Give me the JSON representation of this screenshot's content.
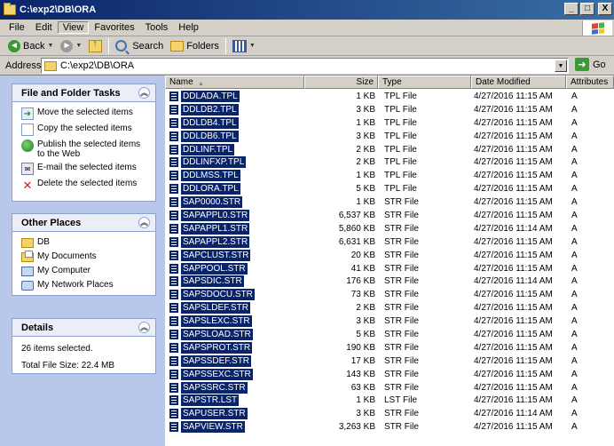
{
  "window": {
    "title": "C:\\exp2\\DB\\ORA",
    "min_label": "_",
    "max_label": "□",
    "close_label": "X"
  },
  "menu": [
    "File",
    "Edit",
    "View",
    "Favorites",
    "Tools",
    "Help"
  ],
  "toolbar": {
    "back_label": "Back",
    "search_label": "Search",
    "folders_label": "Folders"
  },
  "address": {
    "label": "Address",
    "value": "C:\\exp2\\DB\\ORA",
    "go_label": "Go"
  },
  "tasks_panel": {
    "title": "File and Folder Tasks",
    "items": [
      {
        "label": "Move the selected items",
        "icon": "move-icon"
      },
      {
        "label": "Copy the selected items",
        "icon": "copy-icon"
      },
      {
        "label": "Publish the selected items",
        "label2": "to the Web",
        "icon": "web-publish-icon"
      },
      {
        "label": "E-mail the selected items",
        "icon": "email-icon"
      },
      {
        "label": "Delete the selected items",
        "icon": "delete-icon"
      }
    ]
  },
  "places_panel": {
    "title": "Other Places",
    "items": [
      {
        "label": "DB",
        "icon": "folder-icon"
      },
      {
        "label": "My Documents",
        "icon": "my-documents-icon"
      },
      {
        "label": "My Computer",
        "icon": "my-computer-icon"
      },
      {
        "label": "My Network Places",
        "icon": "network-places-icon"
      }
    ]
  },
  "details_panel": {
    "title": "Details",
    "selected": "26 items selected.",
    "total_size": "Total File Size: 22.4 MB"
  },
  "columns": [
    "Name",
    "Size",
    "Type",
    "Date Modified",
    "Attributes"
  ],
  "files": [
    {
      "name": "DDLADA.TPL",
      "size": "1 KB",
      "type": "TPL File",
      "date": "4/27/2016 11:15 AM",
      "attr": "A"
    },
    {
      "name": "DDLDB2.TPL",
      "size": "3 KB",
      "type": "TPL File",
      "date": "4/27/2016 11:15 AM",
      "attr": "A"
    },
    {
      "name": "DDLDB4.TPL",
      "size": "1 KB",
      "type": "TPL File",
      "date": "4/27/2016 11:15 AM",
      "attr": "A"
    },
    {
      "name": "DDLDB6.TPL",
      "size": "3 KB",
      "type": "TPL File",
      "date": "4/27/2016 11:15 AM",
      "attr": "A"
    },
    {
      "name": "DDLINF.TPL",
      "size": "2 KB",
      "type": "TPL File",
      "date": "4/27/2016 11:15 AM",
      "attr": "A"
    },
    {
      "name": "DDLINFXP.TPL",
      "size": "2 KB",
      "type": "TPL File",
      "date": "4/27/2016 11:15 AM",
      "attr": "A"
    },
    {
      "name": "DDLMSS.TPL",
      "size": "1 KB",
      "type": "TPL File",
      "date": "4/27/2016 11:15 AM",
      "attr": "A"
    },
    {
      "name": "DDLORA.TPL",
      "size": "5 KB",
      "type": "TPL File",
      "date": "4/27/2016 11:15 AM",
      "attr": "A"
    },
    {
      "name": "SAP0000.STR",
      "size": "1 KB",
      "type": "STR File",
      "date": "4/27/2016 11:15 AM",
      "attr": "A"
    },
    {
      "name": "SAPAPPL0.STR",
      "size": "6,537 KB",
      "type": "STR File",
      "date": "4/27/2016 11:15 AM",
      "attr": "A"
    },
    {
      "name": "SAPAPPL1.STR",
      "size": "5,860 KB",
      "type": "STR File",
      "date": "4/27/2016 11:14 AM",
      "attr": "A"
    },
    {
      "name": "SAPAPPL2.STR",
      "size": "6,631 KB",
      "type": "STR File",
      "date": "4/27/2016 11:15 AM",
      "attr": "A"
    },
    {
      "name": "SAPCLUST.STR",
      "size": "20 KB",
      "type": "STR File",
      "date": "4/27/2016 11:15 AM",
      "attr": "A"
    },
    {
      "name": "SAPPOOL.STR",
      "size": "41 KB",
      "type": "STR File",
      "date": "4/27/2016 11:15 AM",
      "attr": "A"
    },
    {
      "name": "SAPSDIC.STR",
      "size": "176 KB",
      "type": "STR File",
      "date": "4/27/2016 11:14 AM",
      "attr": "A"
    },
    {
      "name": "SAPSDOCU.STR",
      "size": "73 KB",
      "type": "STR File",
      "date": "4/27/2016 11:15 AM",
      "attr": "A"
    },
    {
      "name": "SAPSLDEF.STR",
      "size": "2 KB",
      "type": "STR File",
      "date": "4/27/2016 11:15 AM",
      "attr": "A"
    },
    {
      "name": "SAPSLEXC.STR",
      "size": "3 KB",
      "type": "STR File",
      "date": "4/27/2016 11:15 AM",
      "attr": "A"
    },
    {
      "name": "SAPSLOAD.STR",
      "size": "5 KB",
      "type": "STR File",
      "date": "4/27/2016 11:15 AM",
      "attr": "A"
    },
    {
      "name": "SAPSPROT.STR",
      "size": "190 KB",
      "type": "STR File",
      "date": "4/27/2016 11:15 AM",
      "attr": "A"
    },
    {
      "name": "SAPSSDEF.STR",
      "size": "17 KB",
      "type": "STR File",
      "date": "4/27/2016 11:15 AM",
      "attr": "A"
    },
    {
      "name": "SAPSSEXC.STR",
      "size": "143 KB",
      "type": "STR File",
      "date": "4/27/2016 11:15 AM",
      "attr": "A"
    },
    {
      "name": "SAPSSRC.STR",
      "size": "63 KB",
      "type": "STR File",
      "date": "4/27/2016 11:15 AM",
      "attr": "A"
    },
    {
      "name": "SAPSTR.LST",
      "size": "1 KB",
      "type": "LST File",
      "date": "4/27/2016 11:15 AM",
      "attr": "A"
    },
    {
      "name": "SAPUSER.STR",
      "size": "3 KB",
      "type": "STR File",
      "date": "4/27/2016 11:14 AM",
      "attr": "A"
    },
    {
      "name": "SAPVIEW.STR",
      "size": "3,263 KB",
      "type": "STR File",
      "date": "4/27/2016 11:15 AM",
      "attr": "A"
    }
  ]
}
